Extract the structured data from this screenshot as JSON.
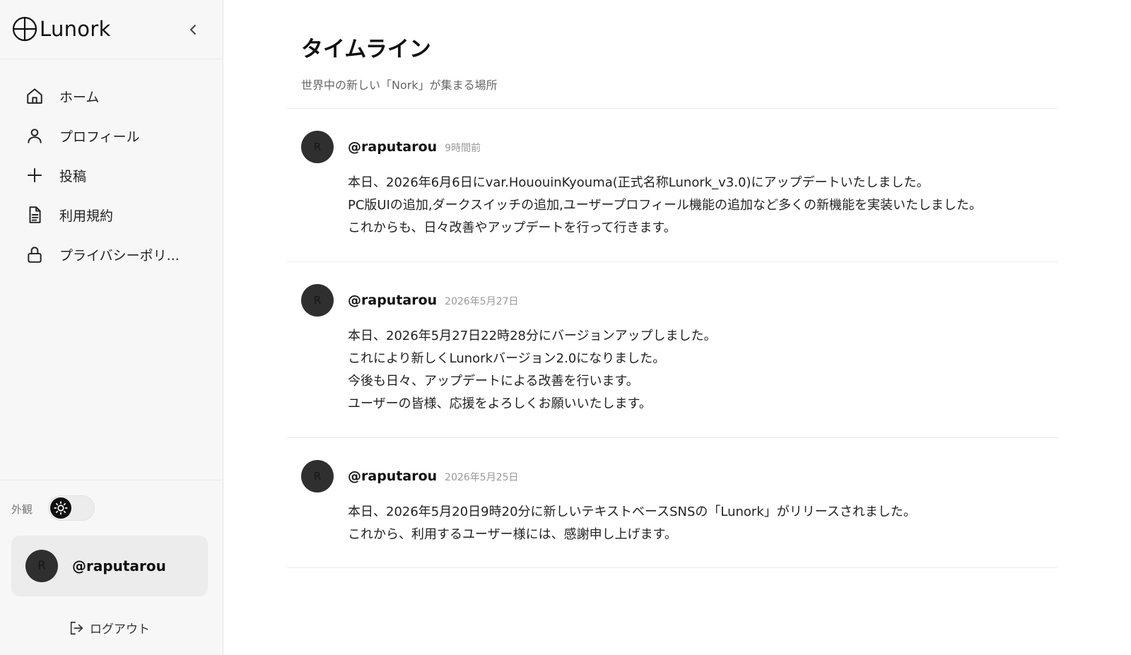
{
  "brand": {
    "name": "Lunork"
  },
  "sidebar": {
    "collapse_icon": "chevron-left-icon",
    "nav": [
      {
        "label": "ホーム",
        "icon": "home-icon"
      },
      {
        "label": "プロフィール",
        "icon": "user-icon"
      },
      {
        "label": "投稿",
        "icon": "plus-icon"
      },
      {
        "label": "利用規約",
        "icon": "document-icon"
      },
      {
        "label": "プライバシーポリ...",
        "icon": "lock-icon"
      }
    ],
    "appearance_label": "外観",
    "theme_toggle": {
      "icon": "sun-icon",
      "mode": "light"
    },
    "user": {
      "avatar_initial": "R",
      "handle": "@raputarou"
    },
    "logout_label": "ログアウト",
    "logout_icon": "logout-icon"
  },
  "main": {
    "title": "タイムライン",
    "subtitle": "世界中の新しい「Nork」が集まる場所",
    "posts": [
      {
        "avatar_initial": "R",
        "user": "@raputarou",
        "time": "9時間前",
        "lines": [
          "本日、2026年6月6日にvar.HououinKyouma(正式名称Lunork_v3.0)にアップデートいたしました。",
          "PC版UIの追加,ダークスイッチの追加,ユーザープロフィール機能の追加など多くの新機能を実装いたしました。",
          "これからも、日々改善やアップデートを行って行きます。"
        ]
      },
      {
        "avatar_initial": "R",
        "user": "@raputarou",
        "time": "2026年5月27日",
        "lines": [
          "本日、2026年5月27日22時28分にバージョンアップしました。",
          "これにより新しくLunorkバージョン2.0になりました。",
          "今後も日々、アップデートによる改善を行います。",
          "ユーザーの皆様、応援をよろしくお願いいたします。"
        ]
      },
      {
        "avatar_initial": "R",
        "user": "@raputarou",
        "time": "2026年5月25日",
        "lines": [
          "本日、2026年5月20日9時20分に新しいテキストベースSNSの「Lunork」がリリースされました。",
          "これから、利用するユーザー様には、感謝申し上げます。"
        ]
      }
    ]
  }
}
